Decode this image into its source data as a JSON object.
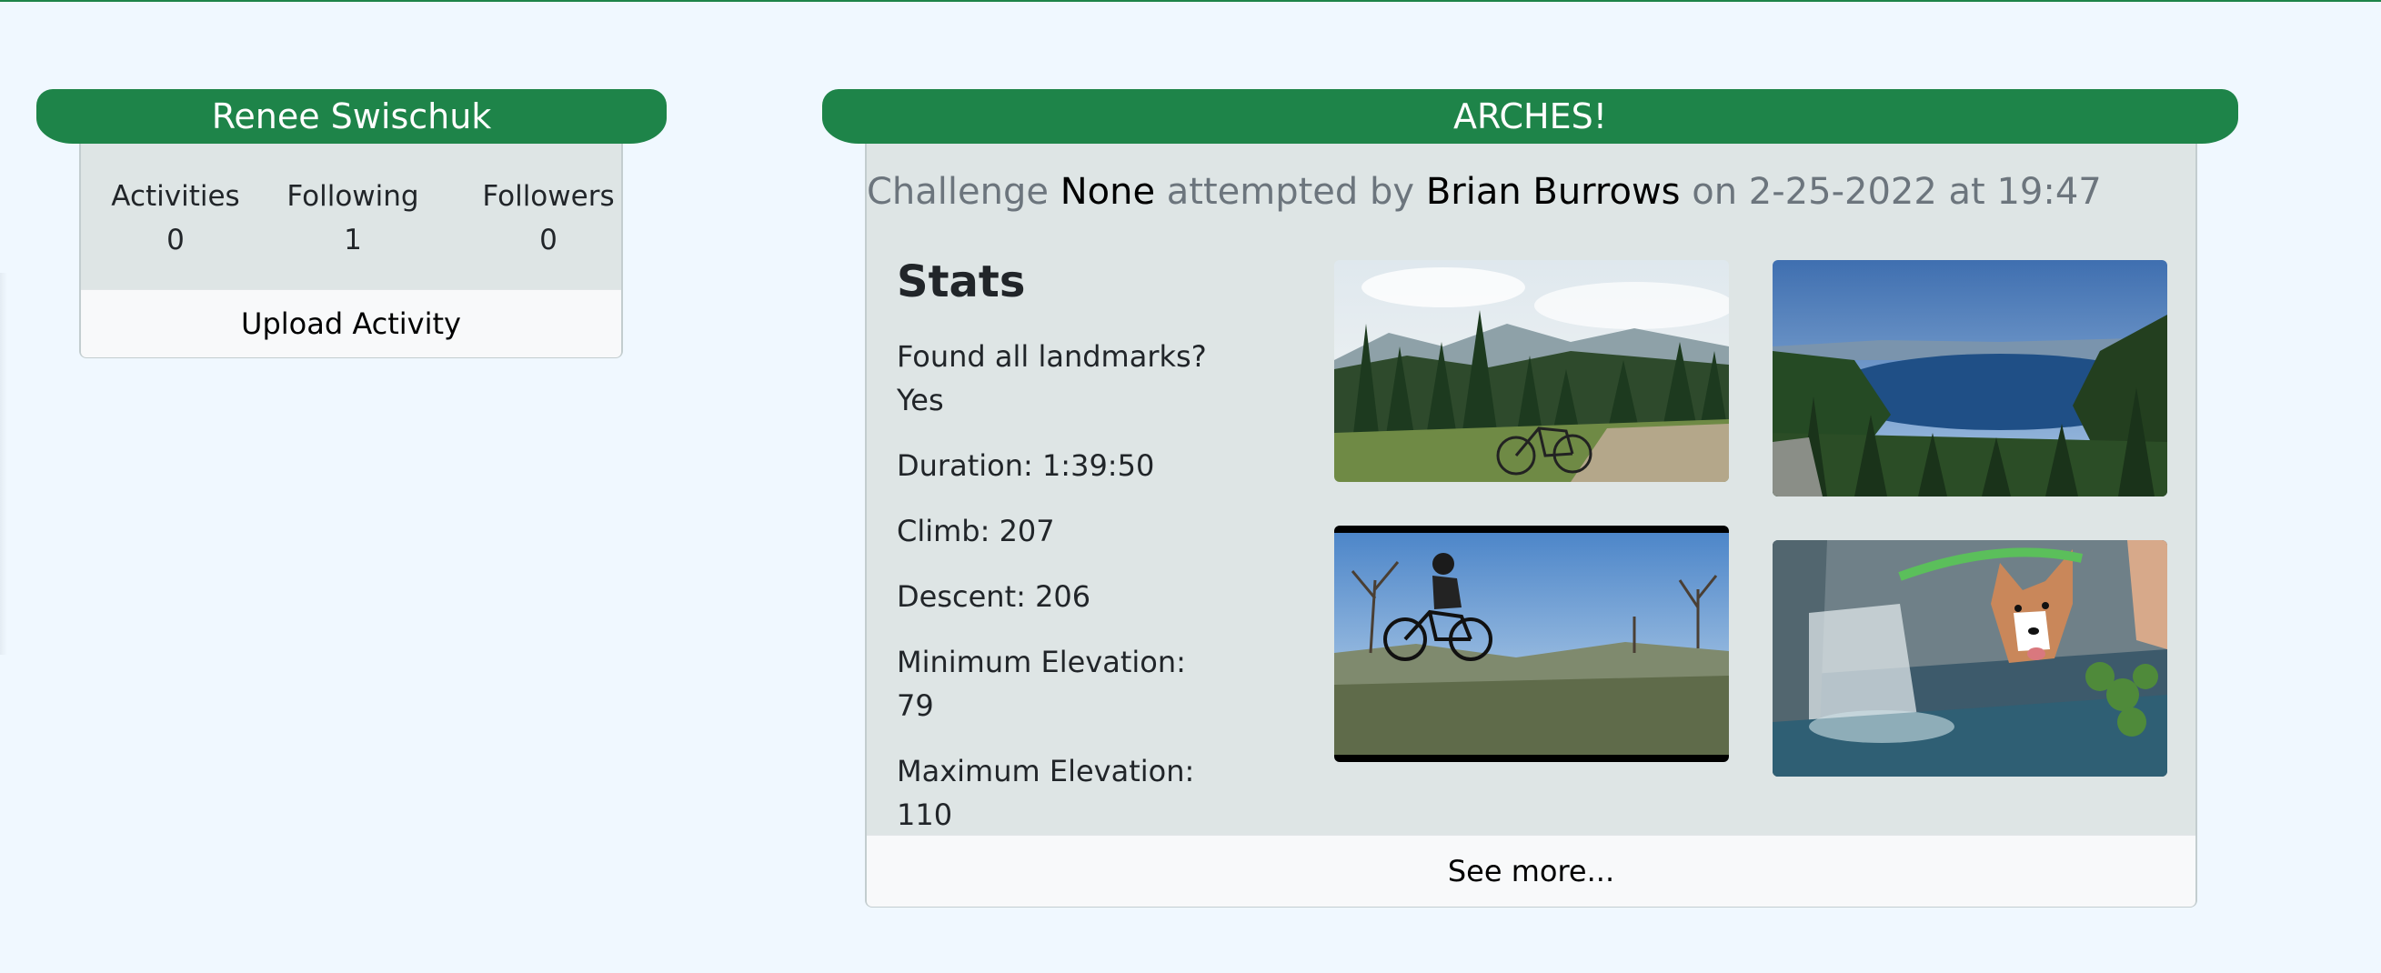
{
  "profile": {
    "name": "Renee Swischuk",
    "stats": [
      {
        "label": "Activities",
        "value": "0"
      },
      {
        "label": "Following",
        "value": "1"
      },
      {
        "label": "Followers",
        "value": "0"
      }
    ],
    "upload_label": "Upload Activity"
  },
  "challenge": {
    "title": "ARCHES!",
    "subtitle": {
      "challenge_word": "Challenge",
      "challenge_name": "None",
      "attempted_by": "attempted by",
      "athlete": "Brian Burrows",
      "on_word": "on",
      "date": "2-25-2022",
      "at_word": "at",
      "time": "19:47"
    },
    "stats_heading": "Stats",
    "stats": {
      "landmarks_label": "Found all landmarks?",
      "landmarks_value": "Yes",
      "duration": "Duration: 1:39:50",
      "climb": "Climb: 207",
      "descent": "Descent: 206",
      "min_elev_label": "Minimum Elevation:",
      "min_elev_value": "79",
      "max_elev_label": "Maximum Elevation:",
      "max_elev_value": "110"
    },
    "photos": [
      {
        "subject": "mountain bike parked on a forest ridge"
      },
      {
        "subject": "alpine lake surrounded by pines"
      },
      {
        "subject": "rider jumping a mountain bike"
      },
      {
        "subject": "dog by a waterfall stream"
      }
    ],
    "see_more_label": "See more..."
  }
}
